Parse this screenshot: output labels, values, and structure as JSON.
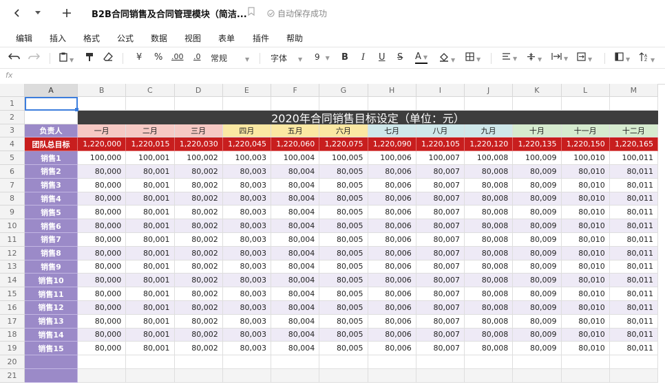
{
  "titlebar": {
    "back_icon": "chevron-left-icon",
    "dropdown_icon": "caret-down-icon",
    "add_icon": "plus-icon",
    "doc_title": "B2B合同销售及合同管理模块（简洁...",
    "bookmark_icon": "bookmark-icon",
    "autosave_text": "自动保存成功"
  },
  "menu": [
    "编辑",
    "插入",
    "格式",
    "公式",
    "数据",
    "视图",
    "表单",
    "插件",
    "帮助"
  ],
  "toolbar": {
    "currency": "¥",
    "percent": "%",
    "decimal_increase": ".00",
    "decimal_decrease": ".0",
    "number_format": "常规",
    "font": "字体",
    "font_size": "9",
    "bold": "B",
    "italic": "I",
    "underline": "U",
    "strike": "S",
    "text_color_letter": "A",
    "text_color": "#111111"
  },
  "formula_bar": {
    "fx_label": "fx",
    "value": ""
  },
  "sheet": {
    "columns": [
      "A",
      "B",
      "C",
      "D",
      "E",
      "F",
      "G",
      "H",
      "I",
      "J",
      "K",
      "L",
      "M"
    ],
    "rows": [
      "1",
      "2",
      "3",
      "4",
      "5",
      "6",
      "7",
      "8",
      "9",
      "10",
      "11",
      "12",
      "13",
      "14",
      "15",
      "16",
      "17",
      "18",
      "19",
      "20",
      "21"
    ],
    "banner": "2020年合同销售目标设定（单位：元）",
    "header_label": "负责人",
    "months": [
      "一月",
      "二月",
      "三月",
      "四月",
      "五月",
      "六月",
      "七月",
      "八月",
      "九月",
      "十月",
      "十一月",
      "十二月"
    ],
    "month_colors": [
      "#f6c9c4",
      "#f6c9c4",
      "#f6c9c4",
      "#fbe8a3",
      "#fbe8a3",
      "#fbe8a3",
      "#cfe8ea",
      "#cfe8ea",
      "#cfe8ea",
      "#d6ebcf",
      "#d6ebcf",
      "#d6ebcf"
    ],
    "team_label": "团队总目标",
    "team_values": [
      "1,220,000",
      "1,220,015",
      "1,220,030",
      "1,220,045",
      "1,220,060",
      "1,220,075",
      "1,220,090",
      "1,220,105",
      "1,220,120",
      "1,220,135",
      "1,220,150",
      "1,220,165"
    ],
    "sales_rows": [
      {
        "name": "销售1",
        "values": [
          "100,000",
          "100,001",
          "100,002",
          "100,003",
          "100,004",
          "100,005",
          "100,006",
          "100,007",
          "100,008",
          "100,009",
          "100,010",
          "100,011"
        ]
      },
      {
        "name": "销售2",
        "values": [
          "80,000",
          "80,001",
          "80,002",
          "80,003",
          "80,004",
          "80,005",
          "80,006",
          "80,007",
          "80,008",
          "80,009",
          "80,010",
          "80,011"
        ]
      },
      {
        "name": "销售3",
        "values": [
          "80,000",
          "80,001",
          "80,002",
          "80,003",
          "80,004",
          "80,005",
          "80,006",
          "80,007",
          "80,008",
          "80,009",
          "80,010",
          "80,011"
        ]
      },
      {
        "name": "销售4",
        "values": [
          "80,000",
          "80,001",
          "80,002",
          "80,003",
          "80,004",
          "80,005",
          "80,006",
          "80,007",
          "80,008",
          "80,009",
          "80,010",
          "80,011"
        ]
      },
      {
        "name": "销售5",
        "values": [
          "80,000",
          "80,001",
          "80,002",
          "80,003",
          "80,004",
          "80,005",
          "80,006",
          "80,007",
          "80,008",
          "80,009",
          "80,010",
          "80,011"
        ]
      },
      {
        "name": "销售6",
        "values": [
          "80,000",
          "80,001",
          "80,002",
          "80,003",
          "80,004",
          "80,005",
          "80,006",
          "80,007",
          "80,008",
          "80,009",
          "80,010",
          "80,011"
        ]
      },
      {
        "name": "销售7",
        "values": [
          "80,000",
          "80,001",
          "80,002",
          "80,003",
          "80,004",
          "80,005",
          "80,006",
          "80,007",
          "80,008",
          "80,009",
          "80,010",
          "80,011"
        ]
      },
      {
        "name": "销售8",
        "values": [
          "80,000",
          "80,001",
          "80,002",
          "80,003",
          "80,004",
          "80,005",
          "80,006",
          "80,007",
          "80,008",
          "80,009",
          "80,010",
          "80,011"
        ]
      },
      {
        "name": "销售9",
        "values": [
          "80,000",
          "80,001",
          "80,002",
          "80,003",
          "80,004",
          "80,005",
          "80,006",
          "80,007",
          "80,008",
          "80,009",
          "80,010",
          "80,011"
        ]
      },
      {
        "name": "销售10",
        "values": [
          "80,000",
          "80,001",
          "80,002",
          "80,003",
          "80,004",
          "80,005",
          "80,006",
          "80,007",
          "80,008",
          "80,009",
          "80,010",
          "80,011"
        ]
      },
      {
        "name": "销售11",
        "values": [
          "80,000",
          "80,001",
          "80,002",
          "80,003",
          "80,004",
          "80,005",
          "80,006",
          "80,007",
          "80,008",
          "80,009",
          "80,010",
          "80,011"
        ]
      },
      {
        "name": "销售12",
        "values": [
          "80,000",
          "80,001",
          "80,002",
          "80,003",
          "80,004",
          "80,005",
          "80,006",
          "80,007",
          "80,008",
          "80,009",
          "80,010",
          "80,011"
        ]
      },
      {
        "name": "销售13",
        "values": [
          "80,000",
          "80,001",
          "80,002",
          "80,003",
          "80,004",
          "80,005",
          "80,006",
          "80,007",
          "80,008",
          "80,009",
          "80,010",
          "80,011"
        ]
      },
      {
        "name": "销售14",
        "values": [
          "80,000",
          "80,001",
          "80,002",
          "80,003",
          "80,004",
          "80,005",
          "80,006",
          "80,007",
          "80,008",
          "80,009",
          "80,010",
          "80,011"
        ]
      },
      {
        "name": "销售15",
        "values": [
          "80,000",
          "80,001",
          "80,002",
          "80,003",
          "80,004",
          "80,005",
          "80,006",
          "80,007",
          "80,008",
          "80,009",
          "80,010",
          "80,011"
        ]
      }
    ],
    "colors": {
      "banner_bg": "#3d3d3d",
      "name_bg": "#9b8ac8",
      "team_bg": "#c81e1e",
      "stripe_bg": "#eeeaf6",
      "selection": "#3b7ddd"
    },
    "selected_cell": "A1"
  }
}
